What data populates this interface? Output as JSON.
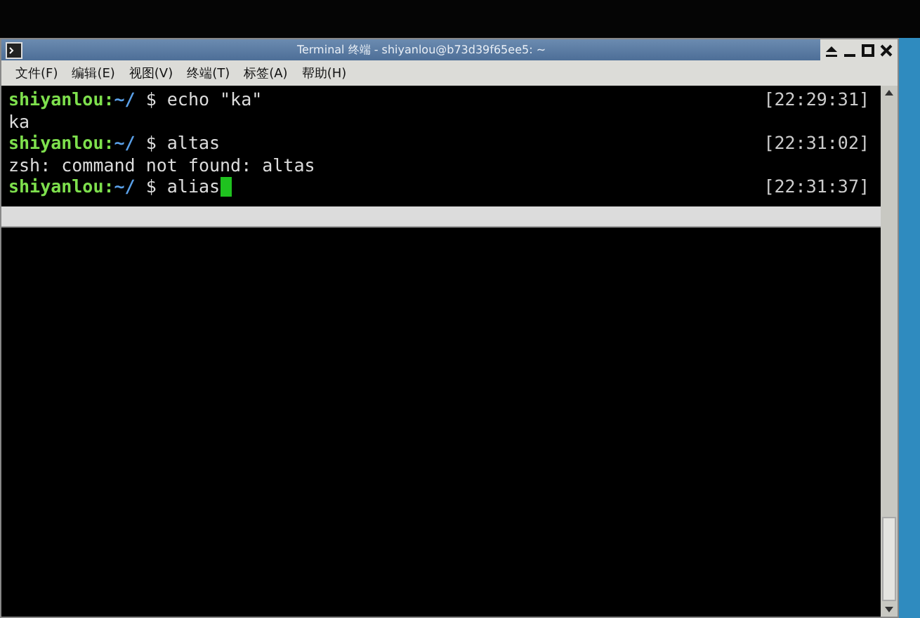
{
  "window": {
    "title": "Terminal 终端 - shiyanlou@b73d39f65ee5: ~"
  },
  "menu": [
    "文件(F)",
    "编辑(E)",
    "视图(V)",
    "终端(T)",
    "标签(A)",
    "帮助(H)"
  ],
  "lines": [
    {
      "kind": "prompt",
      "user": "shiyanlou:",
      "path": "~/",
      "dollar": "$",
      "command": "echo \"ka\"",
      "time": "[22:29:31]"
    },
    {
      "kind": "output",
      "text": "ka"
    },
    {
      "kind": "prompt",
      "user": "shiyanlou:",
      "path": "~/",
      "dollar": "$",
      "command": "altas",
      "time": "[22:31:02]"
    },
    {
      "kind": "output",
      "text": "zsh: command not found: altas"
    },
    {
      "kind": "prompt",
      "user": "shiyanlou:",
      "path": "~/",
      "dollar": "$",
      "command": "alias",
      "time": "[22:31:37]",
      "cursor": true
    }
  ]
}
